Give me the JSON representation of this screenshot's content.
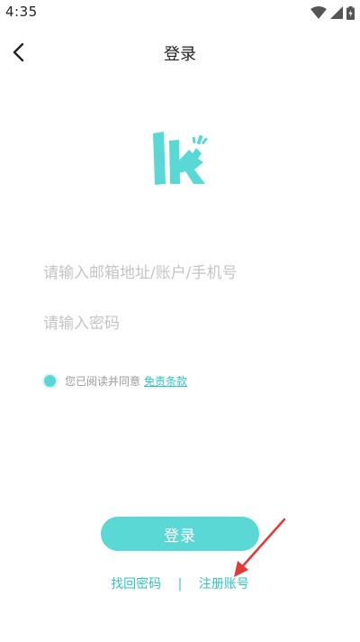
{
  "status_bar": {
    "time": "4:35",
    "icons": [
      "wifi-icon",
      "signal-icon",
      "battery-icon"
    ]
  },
  "header": {
    "back_icon": "chevron-left-icon",
    "title": "登录"
  },
  "logo": {
    "icon": "app-logo-lk",
    "color": "#5ad8d6"
  },
  "form": {
    "account_placeholder": "请输入邮箱地址/账户/手机号",
    "account_value": "",
    "password_placeholder": "请输入密码",
    "password_value": ""
  },
  "agreement": {
    "checked": true,
    "text": "您已阅读并同意",
    "terms_link": "免责条款"
  },
  "login_button": "登录",
  "links": {
    "forgot_password": "找回密码",
    "separator": "|",
    "register": "注册账号"
  },
  "colors": {
    "accent": "#5ad8d6",
    "link": "#2fc4c2",
    "annotation": "#e53935"
  }
}
